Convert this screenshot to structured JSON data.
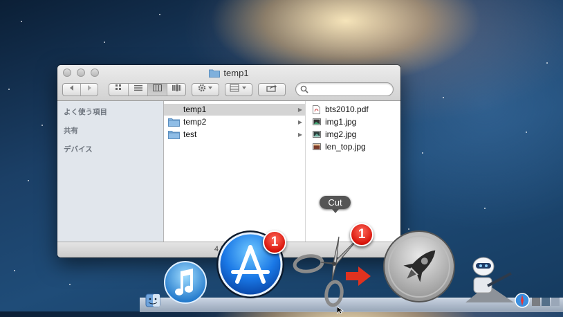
{
  "window": {
    "title": "temp1",
    "sidebar": {
      "sections": [
        "よく使う項目",
        "共有",
        "デバイス"
      ]
    },
    "column1": {
      "items": [
        {
          "label": "temp1",
          "selected": true
        },
        {
          "label": "temp2",
          "selected": false
        },
        {
          "label": "test",
          "selected": false
        }
      ]
    },
    "column2": {
      "items": [
        {
          "label": "bts2010.pdf",
          "icon": "pdf-file-icon"
        },
        {
          "label": "img1.jpg",
          "icon": "image-file-icon"
        },
        {
          "label": "img2.jpg",
          "icon": "image-file-icon"
        },
        {
          "label": "len_top.jpg",
          "icon": "image-file-icon"
        }
      ]
    },
    "status": "4 項目、"
  },
  "tooltip": {
    "label": "Cut"
  },
  "dock": {
    "app_store_badge": "1",
    "cut_badge": "1",
    "items": [
      "finder-icon",
      "itunes-icon",
      "app-store-icon",
      "scissors-icon",
      "arrow-right-icon",
      "launchpad-icon",
      "automator-icon",
      "safari-icon"
    ]
  },
  "colors": {
    "badge": "#d8140a",
    "arrow": "#e0321f",
    "selection": "#d4d4d4"
  }
}
